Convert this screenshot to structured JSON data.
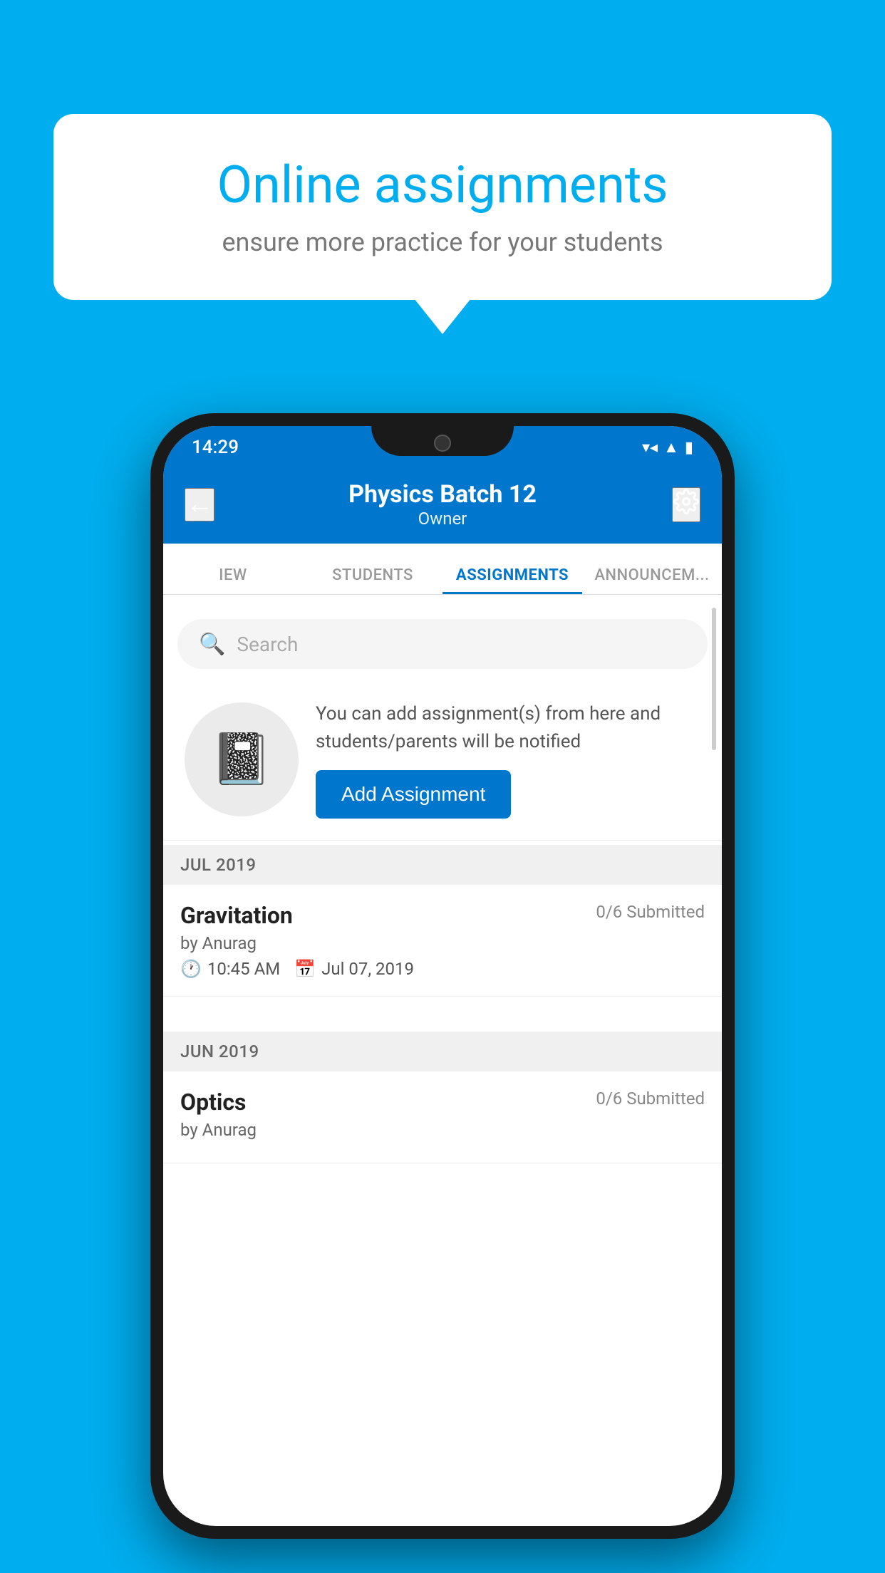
{
  "background_color": "#00AEEF",
  "speech_bubble": {
    "title": "Online assignments",
    "subtitle": "ensure more practice for your students"
  },
  "phone": {
    "status_bar": {
      "time": "14:29",
      "wifi": "▼▲",
      "signal": "▲",
      "battery": "▮"
    },
    "top_bar": {
      "title": "Physics Batch 12",
      "subtitle": "Owner",
      "back_label": "←",
      "settings_label": "⚙"
    },
    "tabs": [
      {
        "label": "IEW",
        "active": false
      },
      {
        "label": "STUDENTS",
        "active": false
      },
      {
        "label": "ASSIGNMENTS",
        "active": true
      },
      {
        "label": "ANNOUNCEM...",
        "active": false
      }
    ],
    "search": {
      "placeholder": "Search"
    },
    "promo": {
      "description": "You can add assignment(s) from here and students/parents will be notified",
      "button_label": "Add Assignment"
    },
    "sections": [
      {
        "month": "JUL 2019",
        "assignments": [
          {
            "name": "Gravitation",
            "submitted": "0/6 Submitted",
            "by": "by Anurag",
            "time": "10:45 AM",
            "date": "Jul 07, 2019"
          }
        ]
      },
      {
        "month": "JUN 2019",
        "assignments": [
          {
            "name": "Optics",
            "submitted": "0/6 Submitted",
            "by": "by Anurag",
            "time": "",
            "date": ""
          }
        ]
      }
    ]
  }
}
